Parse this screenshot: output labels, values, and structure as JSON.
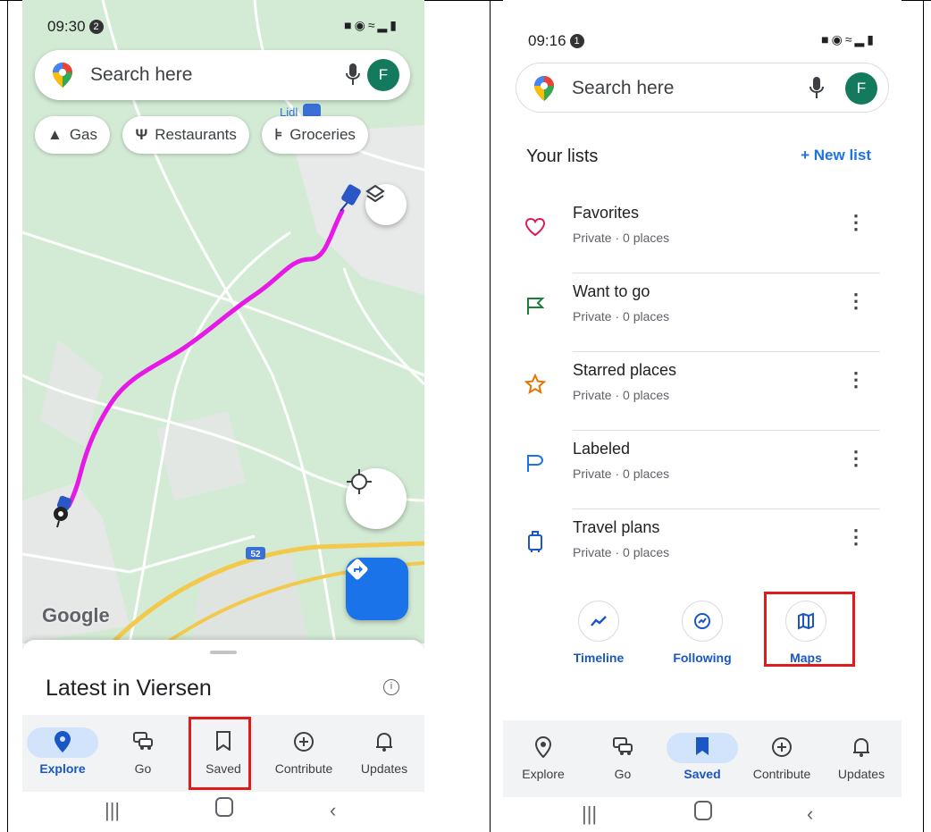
{
  "left": {
    "status": {
      "time": "09:30",
      "badge": "2"
    },
    "search": {
      "placeholder": "Search here",
      "avatar": "F"
    },
    "map_labels": {
      "store": "Lidl",
      "road": "52"
    },
    "chips": [
      {
        "icon": "gas-station-icon",
        "label": "Gas"
      },
      {
        "icon": "restaurant-icon",
        "label": "Restaurants"
      },
      {
        "icon": "cart-icon",
        "label": "Groceries"
      }
    ],
    "attribution": "Google",
    "sheet": {
      "title": "Latest in Viersen"
    },
    "nav": [
      {
        "icon": "explore-icon",
        "label": "Explore",
        "active": true
      },
      {
        "icon": "car-icon",
        "label": "Go"
      },
      {
        "icon": "bookmark-icon",
        "label": "Saved"
      },
      {
        "icon": "contribute-icon",
        "label": "Contribute"
      },
      {
        "icon": "bell-icon",
        "label": "Updates"
      }
    ]
  },
  "right": {
    "status": {
      "time": "09:16",
      "badge": "1"
    },
    "search": {
      "placeholder": "Search here",
      "avatar": "F"
    },
    "lists_title": "Your lists",
    "new_list": "+ New list",
    "lists": [
      {
        "icon": "heart-icon",
        "name": "Favorites",
        "sub": "Private · 0 places"
      },
      {
        "icon": "flag-icon",
        "name": "Want to go",
        "sub": "Private · 0 places"
      },
      {
        "icon": "star-icon",
        "name": "Starred places",
        "sub": "Private · 0 places"
      },
      {
        "icon": "label-icon",
        "name": "Labeled",
        "sub": "Private · 0 places"
      },
      {
        "icon": "luggage-icon",
        "name": "Travel plans",
        "sub": "Private · 0 places"
      }
    ],
    "quick": [
      {
        "icon": "timeline-icon",
        "label": "Timeline"
      },
      {
        "icon": "following-icon",
        "label": "Following"
      },
      {
        "icon": "maps-icon",
        "label": "Maps"
      }
    ],
    "nav": [
      {
        "icon": "explore-icon",
        "label": "Explore"
      },
      {
        "icon": "car-icon",
        "label": "Go"
      },
      {
        "icon": "bookmark-icon",
        "label": "Saved",
        "active": true
      },
      {
        "icon": "contribute-icon",
        "label": "Contribute"
      },
      {
        "icon": "bell-icon",
        "label": "Updates"
      }
    ]
  },
  "colors": {
    "accent": "#1a73e8",
    "route": "#e619e6",
    "highlight": "#e01b1b",
    "avatar": "#137a5e"
  }
}
